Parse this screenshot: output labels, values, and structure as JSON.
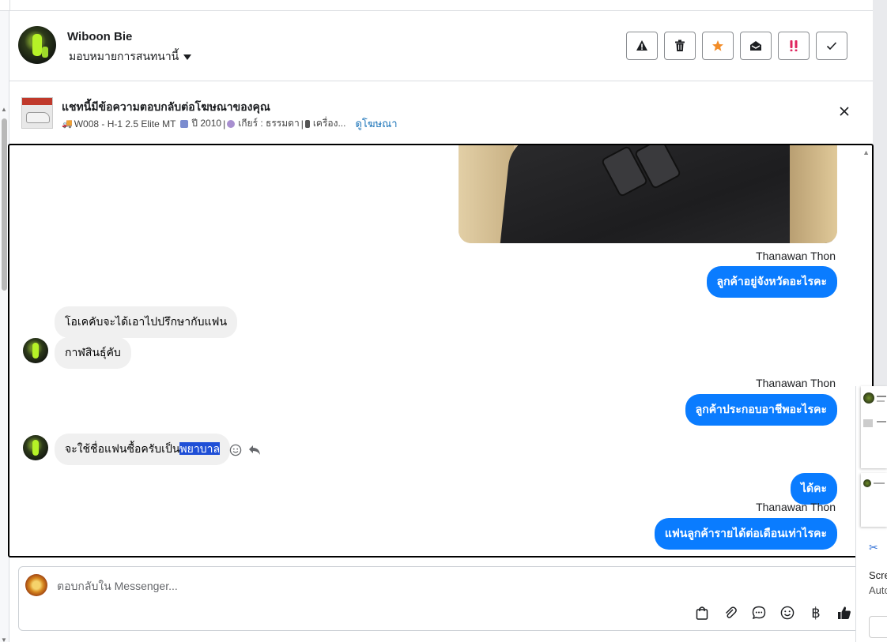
{
  "contact": {
    "name": "Wiboon Bie",
    "assign_label": "มอบหมายการสนทนานี้"
  },
  "header_actions": [
    {
      "icon": "warning-icon",
      "label": "Report"
    },
    {
      "icon": "trash-icon",
      "label": "Delete"
    },
    {
      "icon": "star-icon",
      "label": "Star",
      "color": "#f28c28"
    },
    {
      "icon": "mark-unread-icon",
      "label": "Mark as unread"
    },
    {
      "icon": "priority-icon",
      "label": "Priority",
      "color": "#e0245e"
    },
    {
      "icon": "check-icon",
      "label": "Done"
    }
  ],
  "ad_banner": {
    "title": "แชทนี้มีข้อความตอบกลับต่อโฆษณาของคุณ",
    "details": "W008 - H-1 2.5 Elite MT",
    "year": "ปี 2010",
    "gear": "เกียร์ : ธรรมดา",
    "engine": "เครื่อง...",
    "link": "ดูโฆษณา"
  },
  "messages": {
    "sender_1": "Thanawan Thon",
    "out_1": "ลูกค้าอยู่จังหวัดอะไรคะ",
    "in_1": "โอเคคับจะได้เอาไปปรึกษากับแฟน",
    "in_2": "กาฬสินธุ์คับ",
    "sender_2": "Thanawan Thon",
    "out_2": "ลูกค้าประกอบอาชีพอะไรคะ",
    "in_3_prefix": "จะใช้ชื่อแฟนซื้อครับเป็น",
    "in_3_highlight": "พยาบาล",
    "out_3": "ได้คะ",
    "sender_3": "Thanawan Thon",
    "out_4": "แฟนลูกค้ารายได้ต่อเดือนเท่าไรคะ"
  },
  "composer": {
    "placeholder": "ตอบกลับใน Messenger...",
    "tools": [
      "shopping-bag-icon",
      "paperclip-icon",
      "saved-reply-icon",
      "emoji-icon",
      "baht-icon",
      "thumbs-up-icon"
    ]
  },
  "overlay": {
    "line_1": "Scre",
    "line_2": "Auto"
  },
  "colors": {
    "accent": "#0a7cff",
    "link": "#1a73b8",
    "highlight": "#1f4fd6"
  }
}
